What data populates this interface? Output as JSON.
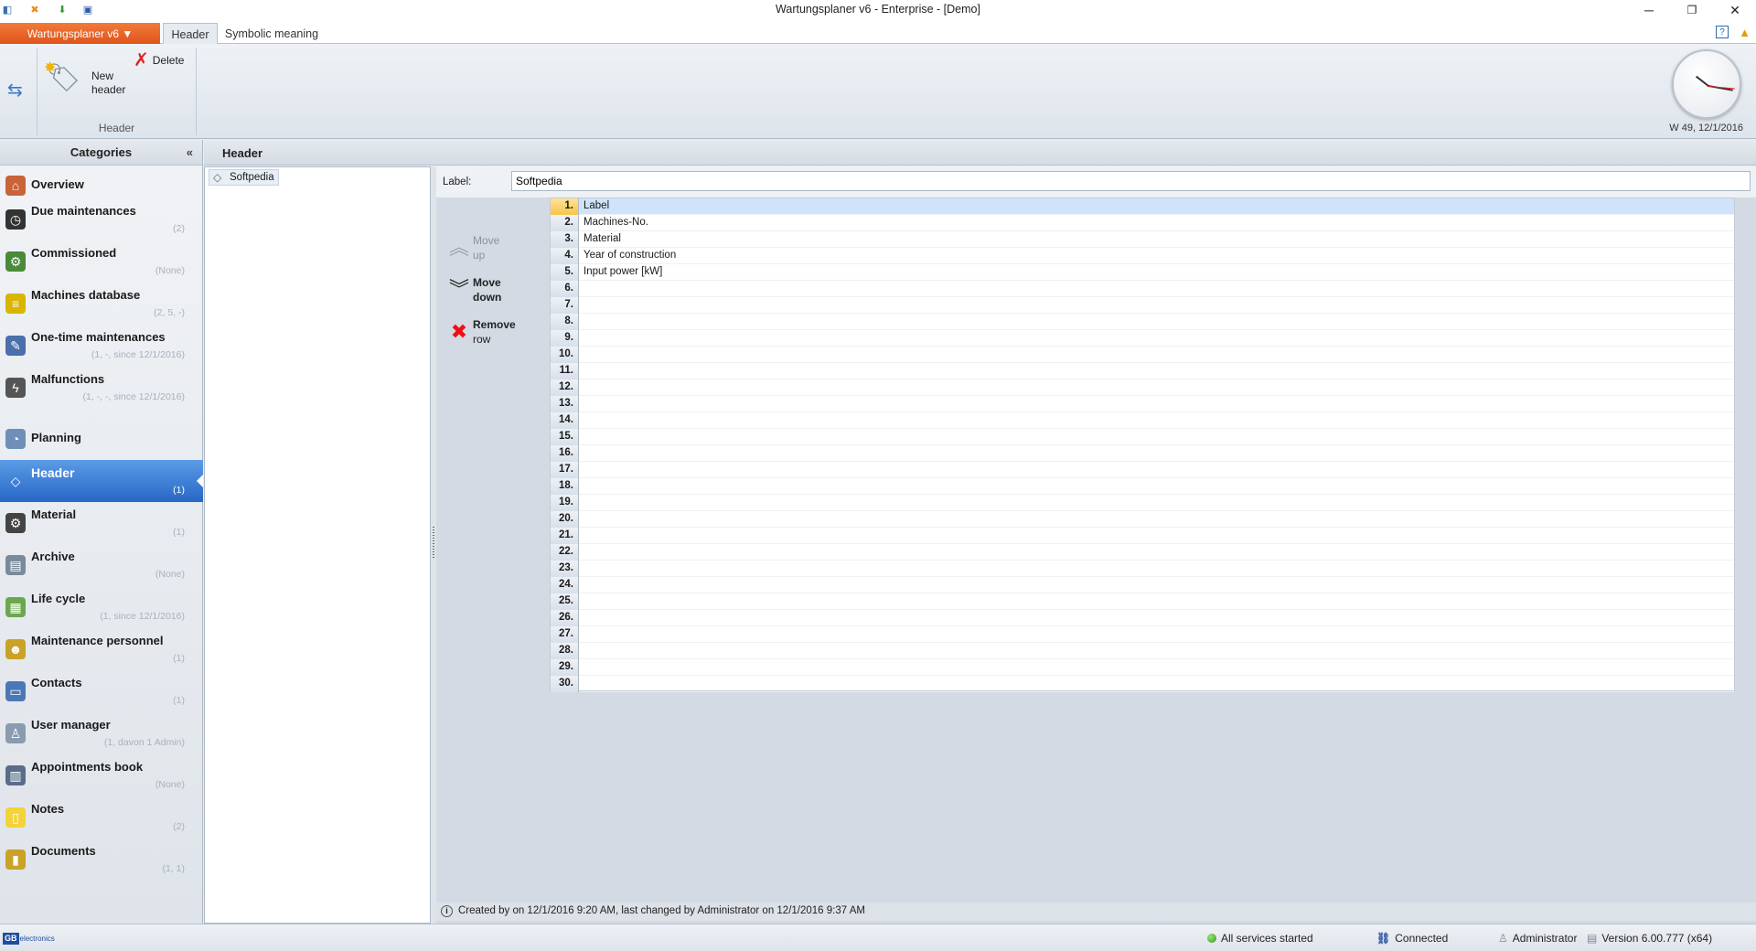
{
  "window": {
    "title": "Wartungsplaner v6 - Enterprise - [Demo]",
    "minimize": "─",
    "restore": "❐",
    "close": "✕"
  },
  "ribbon": {
    "app_menu": "Wartungsplaner v6 ▼",
    "tabs": [
      {
        "label": "Header",
        "active": true
      },
      {
        "label": "Symbolic meaning",
        "active": false
      }
    ],
    "help": "?",
    "new_header_line1": "New",
    "new_header_line2": "header",
    "delete": "Delete",
    "group_label": "Header",
    "week_date": "W 49, 12/1/2016"
  },
  "sidebar": {
    "title": "Categories",
    "collapse": "«",
    "items": [
      {
        "label": "Overview",
        "count": "",
        "icon": "home-icon",
        "color": "#c8633a"
      },
      {
        "label": "Due maintenances",
        "count": "(2)",
        "icon": "clock-icon",
        "color": "#333333"
      },
      {
        "label": "Commissioned",
        "count": "(None)",
        "icon": "gear-icon",
        "color": "#4a8a3a"
      },
      {
        "label": "Machines database",
        "count": "(2, 5, -)",
        "icon": "database-icon",
        "color": "#d9b400"
      },
      {
        "label": "One-time maintenances",
        "count": "(1, -, since 12/1/2016)",
        "icon": "wrench-icon",
        "color": "#4b6fa8"
      },
      {
        "label": "Malfunctions",
        "count": "(1, -, -, since 12/1/2016)",
        "icon": "lightning-icon",
        "color": "#555555"
      },
      {
        "label": "Planning",
        "count": "",
        "icon": "planning-icon",
        "color": "#6f8fb8"
      },
      {
        "label": "Header",
        "count": "(1)",
        "icon": "tag-icon",
        "color": "#ffffff",
        "active": true
      },
      {
        "label": "Material",
        "count": "(1)",
        "icon": "material-icon",
        "color": "#444444"
      },
      {
        "label": "Archive",
        "count": "(None)",
        "icon": "archive-icon",
        "color": "#7b8a99"
      },
      {
        "label": "Life cycle",
        "count": "(1, since 12/1/2016)",
        "icon": "calendar-icon",
        "color": "#6aa84f"
      },
      {
        "label": "Maintenance personnel",
        "count": "(1)",
        "icon": "people-icon",
        "color": "#c9a227"
      },
      {
        "label": "Contacts",
        "count": "(1)",
        "icon": "contacts-icon",
        "color": "#4b78b5"
      },
      {
        "label": "User manager",
        "count": "(1, davon 1 Admin)",
        "icon": "user-icon",
        "color": "#8a9bb0"
      },
      {
        "label": "Appointments book",
        "count": "(None)",
        "icon": "book-icon",
        "color": "#5a6d86"
      },
      {
        "label": "Notes",
        "count": "(2)",
        "icon": "note-icon",
        "color": "#f3d23a"
      },
      {
        "label": "Documents",
        "count": "(1, 1)",
        "icon": "documents-icon",
        "color": "#c9a227"
      }
    ]
  },
  "main": {
    "title": "Header",
    "list_items": [
      "Softpedia"
    ],
    "label_caption": "Label:",
    "label_value": "Softpedia",
    "buttons": {
      "move_up": [
        "Move",
        "up"
      ],
      "move_down": [
        "Move",
        "down"
      ],
      "remove_row": [
        "Remove",
        "row"
      ]
    },
    "rows": [
      {
        "n": "1.",
        "v": "Label"
      },
      {
        "n": "2.",
        "v": "Machines-No."
      },
      {
        "n": "3.",
        "v": "Material"
      },
      {
        "n": "4.",
        "v": "Year of construction"
      },
      {
        "n": "5.",
        "v": "Input power [kW]"
      },
      {
        "n": "6.",
        "v": ""
      },
      {
        "n": "7.",
        "v": ""
      },
      {
        "n": "8.",
        "v": ""
      },
      {
        "n": "9.",
        "v": ""
      },
      {
        "n": "10.",
        "v": ""
      },
      {
        "n": "11.",
        "v": ""
      },
      {
        "n": "12.",
        "v": ""
      },
      {
        "n": "13.",
        "v": ""
      },
      {
        "n": "14.",
        "v": ""
      },
      {
        "n": "15.",
        "v": ""
      },
      {
        "n": "16.",
        "v": ""
      },
      {
        "n": "17.",
        "v": ""
      },
      {
        "n": "18.",
        "v": ""
      },
      {
        "n": "19.",
        "v": ""
      },
      {
        "n": "20.",
        "v": ""
      },
      {
        "n": "21.",
        "v": ""
      },
      {
        "n": "22.",
        "v": ""
      },
      {
        "n": "23.",
        "v": ""
      },
      {
        "n": "24.",
        "v": ""
      },
      {
        "n": "25.",
        "v": ""
      },
      {
        "n": "26.",
        "v": ""
      },
      {
        "n": "27.",
        "v": ""
      },
      {
        "n": "28.",
        "v": ""
      },
      {
        "n": "29.",
        "v": ""
      },
      {
        "n": "30.",
        "v": ""
      }
    ],
    "info_text": "Created by  on 12/1/2016 9:20 AM, last changed by Administrator on 12/1/2016 9:37 AM"
  },
  "statusbar": {
    "logo_gb": "GB",
    "logo_text": "electronics",
    "services": "All services started",
    "connection": "Connected",
    "user": "Administrator",
    "version": "Version 6.00.777 (x64)"
  }
}
